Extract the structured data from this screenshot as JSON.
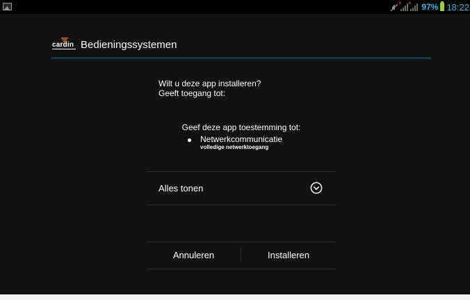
{
  "status_bar": {
    "battery_percent": "97%",
    "time": "18:22",
    "icons": [
      "gallery-icon",
      "muted-icon",
      "signal-icon",
      "signal-icon",
      "battery-icon"
    ],
    "colors": {
      "accent": "#33b5e5",
      "battery": "#9bd22b",
      "no_signal_mark": "#d32f2f"
    }
  },
  "app": {
    "logo_text": "cardin",
    "title": "Bedieningssystemen"
  },
  "dialog": {
    "question": "Wilt u deze app installeren?",
    "access_label": "Geeft toegang tot:",
    "permissions_heading": "Geef deze app toestemming tot:",
    "permissions": [
      {
        "name": "Netwerkcommunicatie",
        "description": "volledige netwerktoegang"
      }
    ],
    "show_all_label": "Alles tonen",
    "cancel_label": "Annuleren",
    "install_label": "Installeren"
  },
  "theme": {
    "background": "#111111",
    "divider": "#143a47",
    "logo_accent": "#e8731a"
  }
}
